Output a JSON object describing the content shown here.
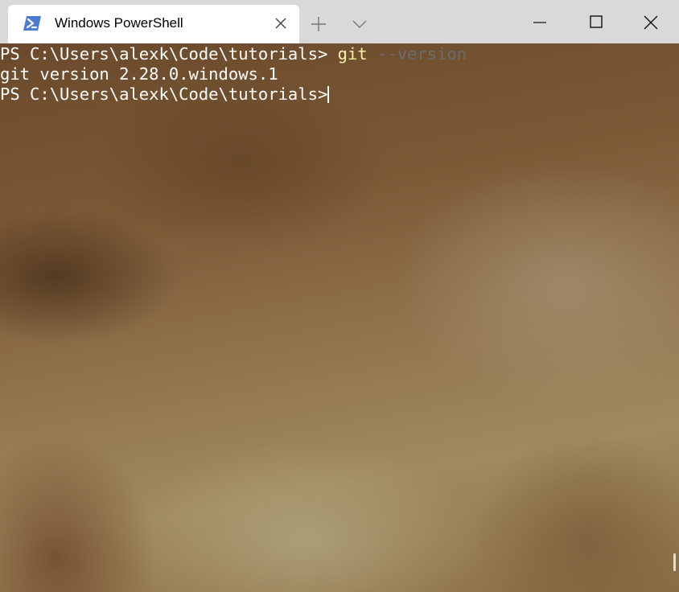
{
  "tab": {
    "title": "Windows PowerShell",
    "icon": "powershell-icon"
  },
  "titlebar": {
    "new_tab_icon": "plus-icon",
    "dropdown_icon": "chevron-down-icon",
    "minimize_icon": "minimize-icon",
    "maximize_icon": "maximize-icon",
    "close_icon": "close-icon"
  },
  "terminal": {
    "line1": {
      "prompt": "PS C:\\Users\\alexk\\Code\\tutorials> ",
      "command": "git",
      "argument": " --version"
    },
    "line2": {
      "output": "git version 2.28.0.windows.1"
    },
    "line3": {
      "prompt": "PS C:\\Users\\alexk\\Code\\tutorials> "
    }
  },
  "colors": {
    "titlebar": "#d9d9d9",
    "tab_active": "#ffffff",
    "prompt_text": "#ffffff",
    "command_text": "#f9f1a5",
    "argument_text": "#6c6c6c",
    "powershell_accent": "#4a7bd4"
  }
}
